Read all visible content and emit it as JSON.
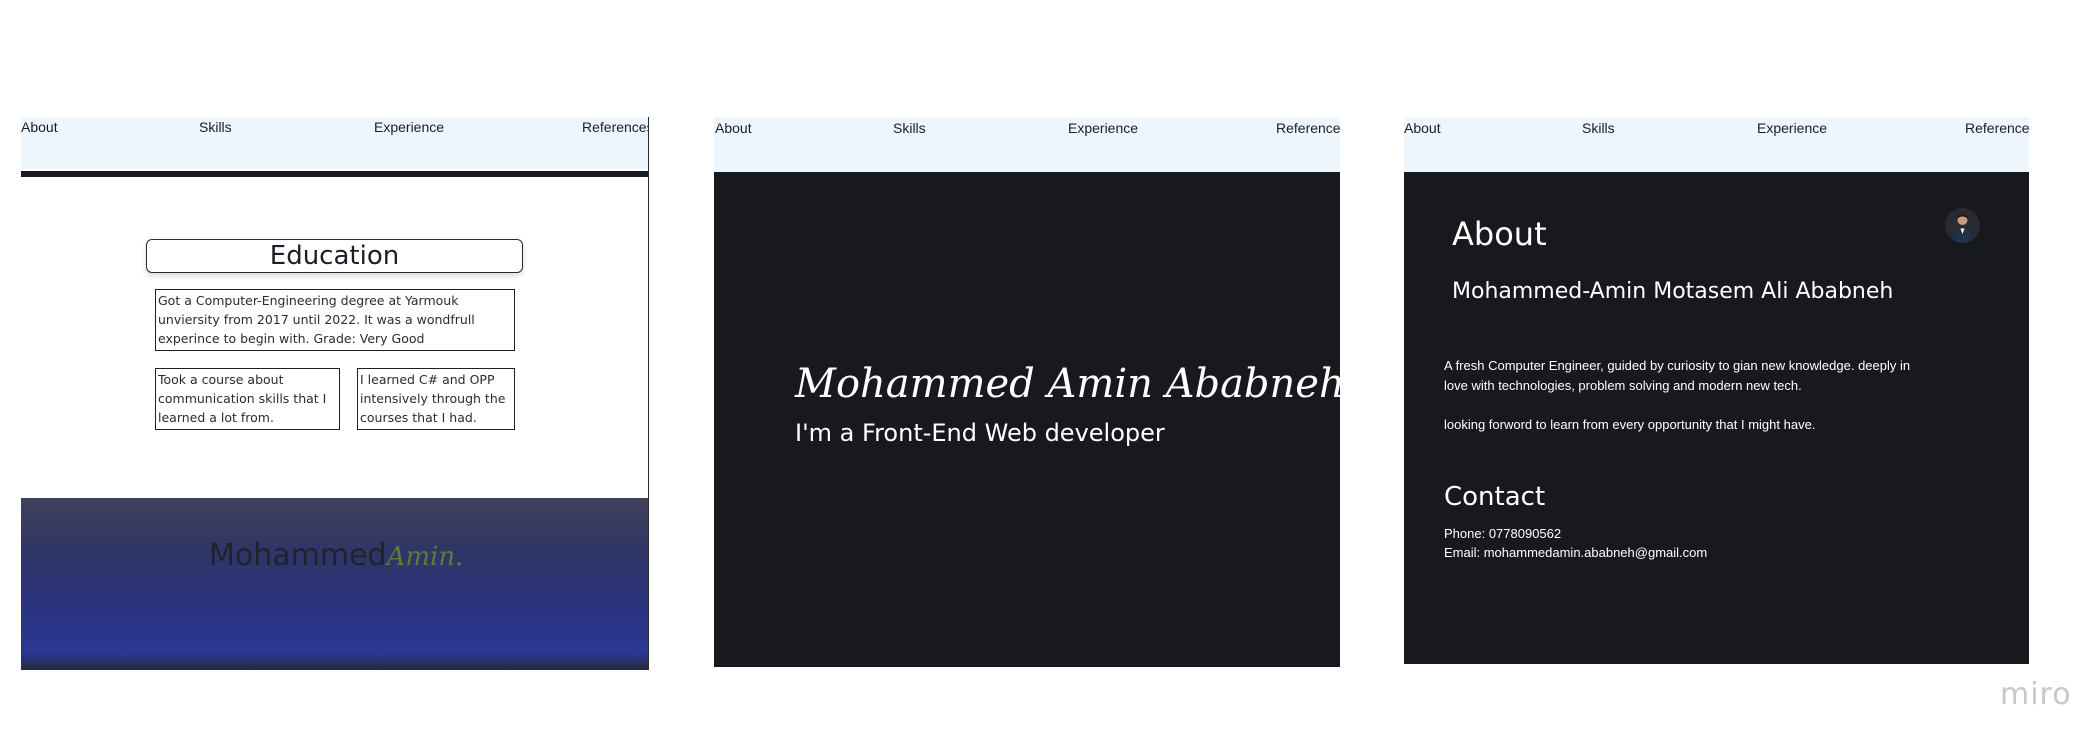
{
  "nav": {
    "about": "About",
    "skills": "Skills",
    "experience": "Experience",
    "references": "References"
  },
  "frame1": {
    "education_title": "Education",
    "degree_text": "Got a Computer-Engineering degree at Yarmouk unviersity from 2017 until 2022. It was a wondfrull experince to begin with. Grade: Very Good",
    "course_text": "Took a course about communication skills that I learned a lot from.",
    "csharp_text": "I learned C# and OPP intensively through the courses that I had.",
    "footer_logo_main": "Mohammed",
    "footer_logo_script": "Amin."
  },
  "frame2": {
    "hero_name": "Mohammed Amin Ababneh",
    "hero_subtitle": "I'm a Front-End Web developer"
  },
  "frame3": {
    "about_title": "About",
    "full_name": "Mohammed-Amin Motasem Ali Ababneh",
    "bio_1": "A fresh Computer Engineer, guided by curiosity to gian new knowledge. deeply in love with technologies, problem solving and modern new tech.",
    "bio_2": "looking forword to learn from every opportunity that I might have.",
    "contact_title": "Contact",
    "phone": "Phone: 0778090562",
    "email": "Email: mohammedamin.ababneh@gmail.com"
  },
  "watermark": "miro",
  "colors": {
    "nav_bg": "#eef6fd",
    "dark_bg": "#18181f",
    "footer_gradient_end": "#2a3794",
    "logo_script": "#5f7a3a"
  }
}
